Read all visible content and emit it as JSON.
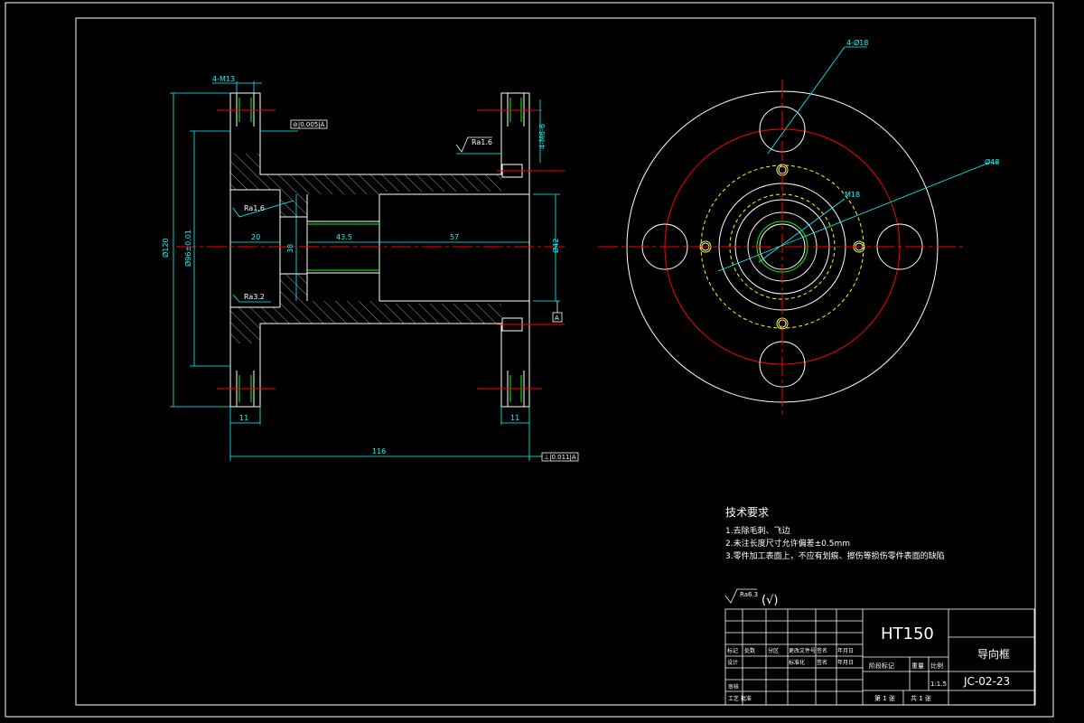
{
  "drawing": {
    "palette": {
      "background": "#000000",
      "line": "#ffffff",
      "dimension": "#00ffff",
      "center": "#ff0000",
      "hidden": "#ffff00",
      "thread": "#00ff00"
    },
    "section_view": {
      "dims": {
        "holes_top": "4-M13",
        "dia_outer": "Ø120",
        "dia_pcd": "Ø96±0.01",
        "len_counterbore": "20",
        "dia_bore": "38",
        "len_mid": "43.5",
        "len_right": "57",
        "dia_right": "Ø42",
        "holes_right": "4-M6-6",
        "flange_left": "11",
        "flange_right": "11",
        "total_len": "116"
      },
      "roughness": {
        "top_right": "Ra1.6",
        "inner": "Ra1.6",
        "bottom": "Ra3.2"
      },
      "tolerances": {
        "flatness": "⊘|0.005|A",
        "perp": "⊥|0.011|A",
        "datum": "A"
      }
    },
    "end_view": {
      "dims": {
        "holes": "4-Ø18",
        "dia_big": "Ø48",
        "dia_small": "M18"
      }
    },
    "tech_requirements": {
      "title": "技术要求",
      "items": [
        "1.去除毛刺、飞边",
        "2.未注长度尺寸允许偏差±0.5mm",
        "3.零件加工表面上，不应有划痕、擦伤等损伤零件表面的缺陷"
      ]
    },
    "general_roughness": {
      "symbol": "Ra6.3",
      "suffix": "(√)"
    },
    "title_block": {
      "material": "HT150",
      "part_name": "导向框",
      "drawing_no": "JC-02-23",
      "scale": "1:1.5",
      "sheet_of": "第 1 张",
      "sheet_total": "共 1 张",
      "headers_row1": [
        "标记",
        "处数",
        "分区",
        "更改文件号",
        "签名",
        "年月日"
      ],
      "headers_row2": [
        "设计",
        "",
        "",
        "标准化",
        "签名",
        "年月日"
      ],
      "labels": {
        "stage": "阶段标记",
        "weight": "重量",
        "scale": "比例",
        "review": "审核",
        "process": "工艺 批准"
      }
    }
  }
}
